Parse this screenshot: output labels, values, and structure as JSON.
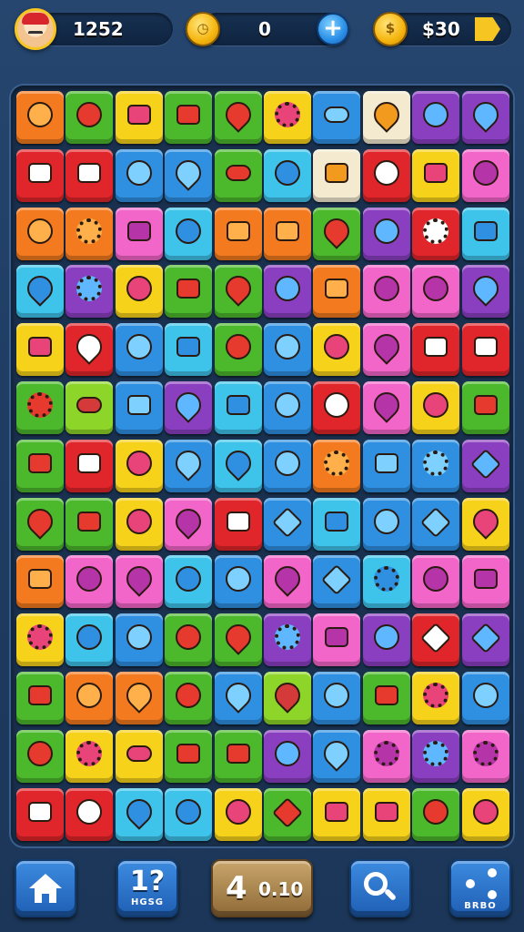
{
  "top_bar": {
    "score": "1252",
    "center_counter": "0",
    "coins": "$30"
  },
  "bottom_bar": {
    "hint_number": "1?",
    "hint_caption": "HGSG",
    "moves": "4",
    "timer": "0.10",
    "share_caption": "BRBO"
  },
  "colors": {
    "orange": "#f47a1f",
    "green": "#4cb82c",
    "yellow": "#f6d21a",
    "red": "#e0262b",
    "blue": "#2f8fe0",
    "cyan": "#3ec3ea",
    "purple": "#8a3fc0",
    "pink": "#f266c9",
    "cream": "#f3ead0",
    "lime": "#8ed52a"
  },
  "board": [
    [
      "orange",
      "green",
      "yellow",
      "green",
      "green",
      "yellow",
      "blue",
      "cream",
      "purple",
      "purple"
    ],
    [
      "red",
      "red",
      "blue",
      "blue",
      "green",
      "cyan",
      "cream",
      "red",
      "yellow",
      "pink"
    ],
    [
      "orange",
      "orange",
      "pink",
      "cyan",
      "orange",
      "orange",
      "green",
      "purple",
      "red",
      "cyan"
    ],
    [
      "cyan",
      "purple",
      "yellow",
      "green",
      "green",
      "purple",
      "orange",
      "pink",
      "pink",
      "purple"
    ],
    [
      "yellow",
      "red",
      "blue",
      "cyan",
      "green",
      "blue",
      "yellow",
      "pink",
      "red",
      "red"
    ],
    [
      "green",
      "lime",
      "blue",
      "purple",
      "cyan",
      "blue",
      "red",
      "pink",
      "yellow",
      "green"
    ],
    [
      "green",
      "red",
      "yellow",
      "blue",
      "cyan",
      "blue",
      "orange",
      "blue",
      "blue",
      "purple"
    ],
    [
      "green",
      "green",
      "yellow",
      "pink",
      "red",
      "blue",
      "cyan",
      "blue",
      "blue",
      "yellow"
    ],
    [
      "orange",
      "pink",
      "pink",
      "cyan",
      "blue",
      "pink",
      "blue",
      "cyan",
      "pink",
      "pink"
    ],
    [
      "yellow",
      "cyan",
      "blue",
      "green",
      "green",
      "purple",
      "pink",
      "purple",
      "red",
      "purple"
    ],
    [
      "green",
      "orange",
      "orange",
      "green",
      "blue",
      "lime",
      "blue",
      "green",
      "yellow",
      "blue"
    ],
    [
      "green",
      "yellow",
      "yellow",
      "green",
      "green",
      "purple",
      "blue",
      "pink",
      "purple",
      "pink"
    ],
    [
      "red",
      "red",
      "cyan",
      "cyan",
      "yellow",
      "green",
      "yellow",
      "yellow",
      "green",
      "yellow"
    ]
  ],
  "icons": [
    [
      "fruit",
      "fruit",
      "box",
      "box",
      "drop",
      "gear",
      "pill",
      "drop",
      "round",
      "drop"
    ],
    [
      "face",
      "dice",
      "fruit",
      "drop",
      "pill",
      "round",
      "rect",
      "round",
      "rect",
      "fruit"
    ],
    [
      "fruit",
      "gear",
      "rect",
      "fruit",
      "rect",
      "rect",
      "drop",
      "round",
      "gear",
      "face"
    ],
    [
      "drop",
      "gear",
      "fruit",
      "box",
      "drop",
      "round",
      "face",
      "fruit",
      "round",
      "drop"
    ],
    [
      "face",
      "drop",
      "round",
      "rect",
      "fruit",
      "round",
      "fruit",
      "drop",
      "rect",
      "face"
    ],
    [
      "gear",
      "pill",
      "rect",
      "drop",
      "rect",
      "fruit",
      "round",
      "drop",
      "fruit",
      "rect"
    ],
    [
      "face",
      "rect",
      "fruit",
      "drop",
      "drop",
      "round",
      "gear",
      "rect",
      "gear",
      "diamond"
    ],
    [
      "drop",
      "rect",
      "round",
      "drop",
      "rect",
      "diamond",
      "rect",
      "round",
      "diamond",
      "drop"
    ],
    [
      "face",
      "fruit",
      "drop",
      "round",
      "round",
      "drop",
      "diamond",
      "gear",
      "fruit",
      "face"
    ],
    [
      "gear",
      "round",
      "round",
      "fruit",
      "drop",
      "gear",
      "rect",
      "round",
      "diamond",
      "diamond"
    ],
    [
      "rect",
      "round",
      "drop",
      "fruit",
      "drop",
      "drop",
      "round",
      "rect",
      "gear",
      "round"
    ],
    [
      "fruit",
      "gear",
      "pill",
      "rect",
      "face",
      "round",
      "drop",
      "gear",
      "gear",
      "gear"
    ],
    [
      "face",
      "fruit",
      "drop",
      "round",
      "round",
      "diamond",
      "rect",
      "rect",
      "round",
      "round"
    ]
  ]
}
